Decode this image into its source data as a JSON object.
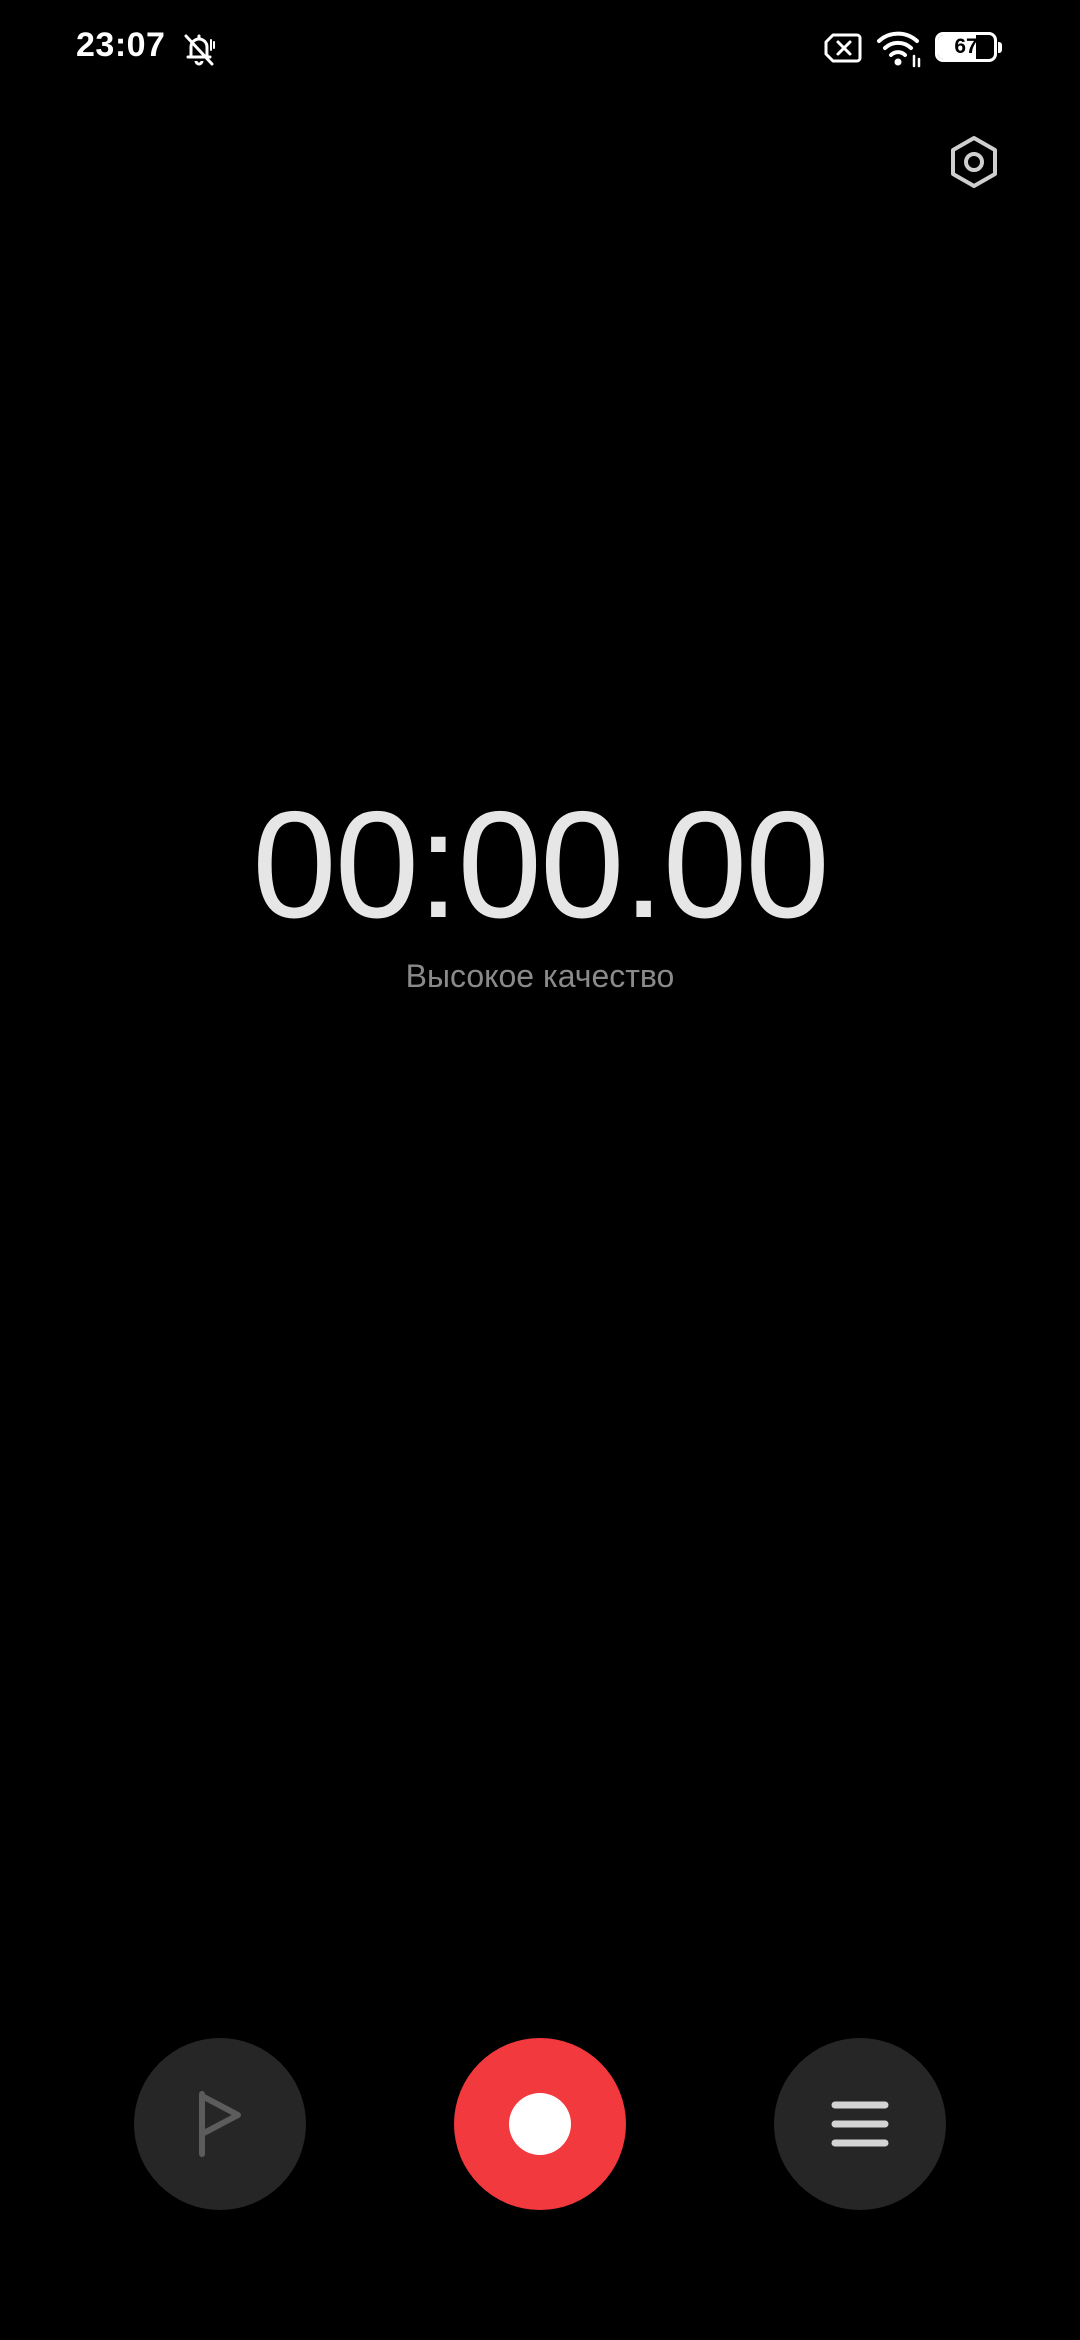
{
  "status_bar": {
    "time": "23:07",
    "battery_level": "67",
    "icons": [
      "bell-off-icon",
      "sim-no-signal-icon",
      "wifi-icon",
      "battery-icon"
    ]
  },
  "header": {
    "settings_icon": "gear-icon"
  },
  "recorder": {
    "timer": "00:00.00",
    "quality": "Высокое качество"
  },
  "controls": {
    "flag_icon": "flag-icon",
    "record_icon": "record-icon",
    "list_icon": "list-icon"
  },
  "colors": {
    "background": "#000000",
    "record_accent": "#f2393d",
    "control_bg": "#262626",
    "timer_text": "#e6e6e6",
    "secondary_text": "#8a8a8a"
  }
}
